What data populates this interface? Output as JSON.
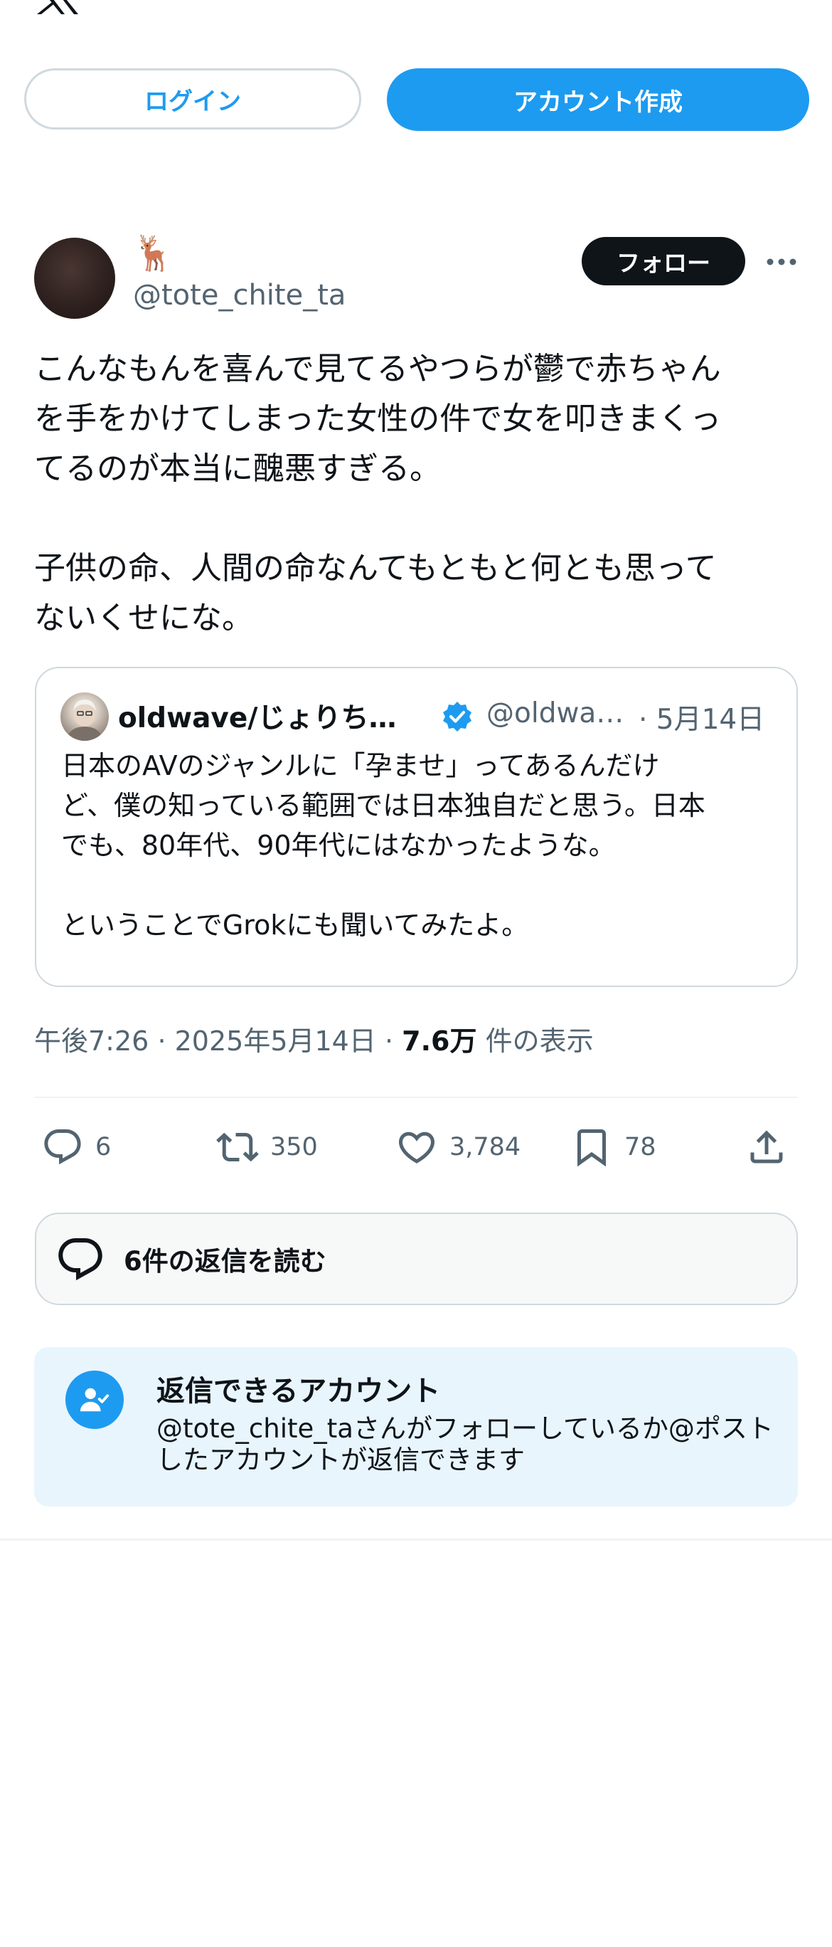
{
  "header": {
    "logo_icon": "x-logo-icon"
  },
  "auth": {
    "login_label": "ログイン",
    "signup_label": "アカウント作成"
  },
  "author": {
    "display_name": "🦌",
    "handle": "@tote_chite_ta",
    "follow_label": "フォロー",
    "more_icon": "more-icon"
  },
  "post": {
    "text": "こんなもんを喜んで見てるやつらが鬱で赤ちゃん\nを手をかけてしまった女性の件で女を叩きまくっ\nてるのが本当に醜悪すぎる。\n\n子供の命、人間の命なんてもともと何とも思って\nないくせにな。"
  },
  "quote": {
    "name": "oldwave/じょりち…",
    "handle": "@oldwa…",
    "date": "· 5月14日",
    "text": "日本のAVのジャンルに「孕ませ」ってあるんだけ\nど、僕の知っている範囲では日本独自だと思う。日本\nでも、80年代、90年代にはなかったような。\n\nということでGrokにも聞いてみたよ。",
    "verified_icon": "verified-badge-icon"
  },
  "meta": {
    "time": "午後7:26",
    "date": "2025年5月14日",
    "sep": "·",
    "views_count": "7.6万",
    "views_suffix": "件の表示"
  },
  "actions": {
    "replies": "6",
    "reposts": "350",
    "likes": "3,784",
    "bookmarks": "78"
  },
  "read_replies": {
    "label": "6件の返信を読む"
  },
  "reply_restriction": {
    "title": "返信できるアカウント",
    "description": "@tote_chite_taさんがフォローしているか@ポストしたアカウントが返信できます"
  },
  "colors": {
    "accent": "#1d9bf0",
    "text": "#0f1419",
    "muted": "#536471",
    "border": "#cfd9de",
    "info_bg": "#e8f5fd"
  }
}
